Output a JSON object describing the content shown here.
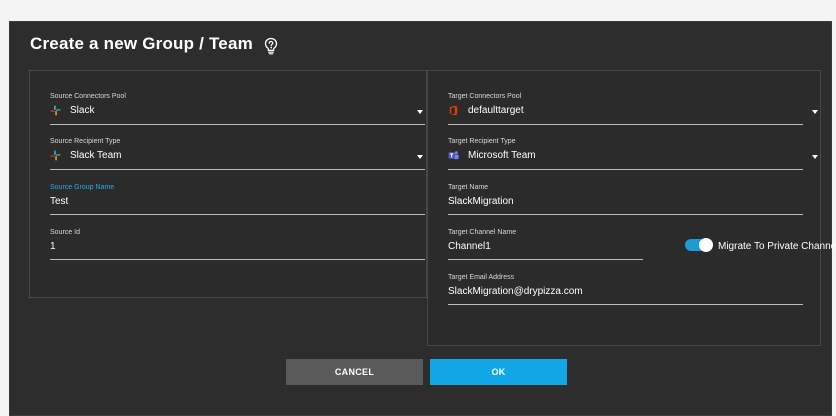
{
  "dialog": {
    "title": "Create a new Group / Team",
    "help_icon": "question-bulb-icon"
  },
  "source": {
    "connectors_pool": {
      "label": "Source Connectors Pool",
      "value": "Slack",
      "icon": "slack-icon"
    },
    "recipient_type": {
      "label": "Source Recipient Type",
      "value": "Slack Team",
      "icon": "slack-icon"
    },
    "group_name": {
      "label": "Source Group Name",
      "value": "Test"
    },
    "source_id": {
      "label": "Source Id",
      "value": "1"
    }
  },
  "target": {
    "connectors_pool": {
      "label": "Target Connectors Pool",
      "value": "defaulttarget",
      "icon": "office-icon"
    },
    "recipient_type": {
      "label": "Target Recipient Type",
      "value": "Microsoft Team",
      "icon": "teams-icon"
    },
    "name": {
      "label": "Target Name",
      "value": "SlackMigration"
    },
    "channel_name": {
      "label": "Target Channel Name",
      "value": "Channel1"
    },
    "private_toggle": {
      "label": "Migrate To Private Channel",
      "on": true
    },
    "email": {
      "label": "Target Email Address",
      "value": "SlackMigration@drypizza.com"
    }
  },
  "buttons": {
    "cancel": "CANCEL",
    "ok": "OK"
  },
  "colors": {
    "accent": "#12a8e8",
    "dialog_bg": "#2d2d2d",
    "cancel_bg": "#5a5a5a"
  }
}
